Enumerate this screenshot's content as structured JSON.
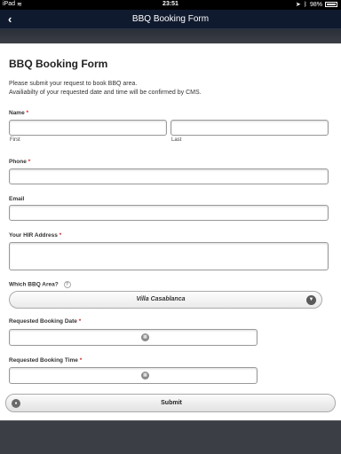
{
  "status_bar": {
    "carrier": "iPad",
    "wifi_icon": "wifi-icon",
    "time": "23:51",
    "battery_pct": "98%"
  },
  "nav": {
    "title": "BBQ Booking Form",
    "back_icon": "chevron-left-icon"
  },
  "form": {
    "title": "BBQ Booking Form",
    "intro_line1": "Please submit your request to book BBQ area.",
    "intro_line2": "Availiabilty of your requested date and time will be confirmed by CMS.",
    "name_label": "Name",
    "first_sub": "First",
    "last_sub": "Last",
    "phone_label": "Phone",
    "email_label": "Email",
    "address_label": "Your HIR Address",
    "area_label": "Which BBQ Area?",
    "area_help": "?",
    "area_value": "Villa Casablanca",
    "date_label": "Requested Booking Date",
    "time_label": "Requested Booking Time",
    "submit_label": "Submit",
    "required_mark": "*"
  }
}
